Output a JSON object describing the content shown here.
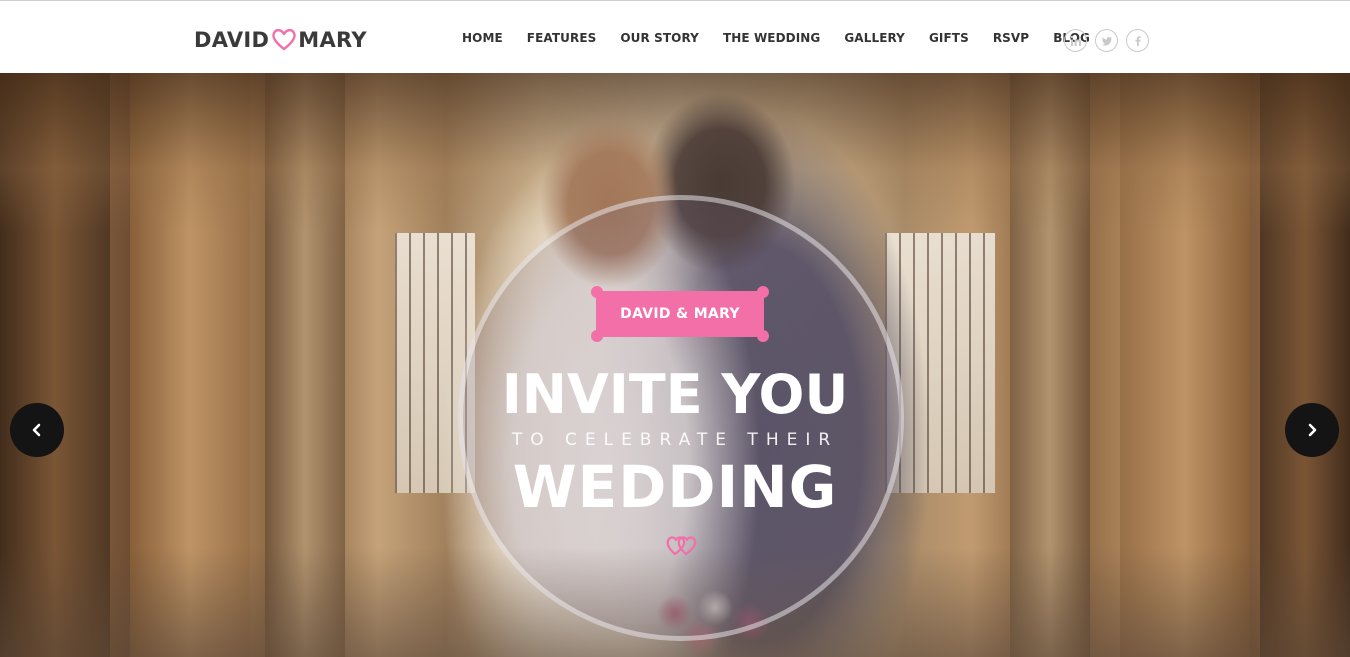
{
  "brand": {
    "first": "DAVID",
    "second": "MARY",
    "accent": "#f36fa8",
    "icon": "heart-icon"
  },
  "nav": {
    "items": [
      {
        "label": "HOME"
      },
      {
        "label": "FEATURES"
      },
      {
        "label": "OUR STORY"
      },
      {
        "label": "THE WEDDING"
      },
      {
        "label": "GALLERY"
      },
      {
        "label": "GIFTS"
      },
      {
        "label": "RSVP"
      },
      {
        "label": "BLOG"
      }
    ]
  },
  "socials": [
    {
      "icon": "linkedin-icon"
    },
    {
      "icon": "twitter-icon"
    },
    {
      "icon": "facebook-icon"
    }
  ],
  "hero": {
    "badge": "DAVID & MARY",
    "line1": "INVITE YOU",
    "line2": "TO CELEBRATE THEIR",
    "line3": "WEDDING",
    "icon": "wedding-rings-icon",
    "prev_icon": "chevron-left-icon",
    "next_icon": "chevron-right-icon"
  }
}
